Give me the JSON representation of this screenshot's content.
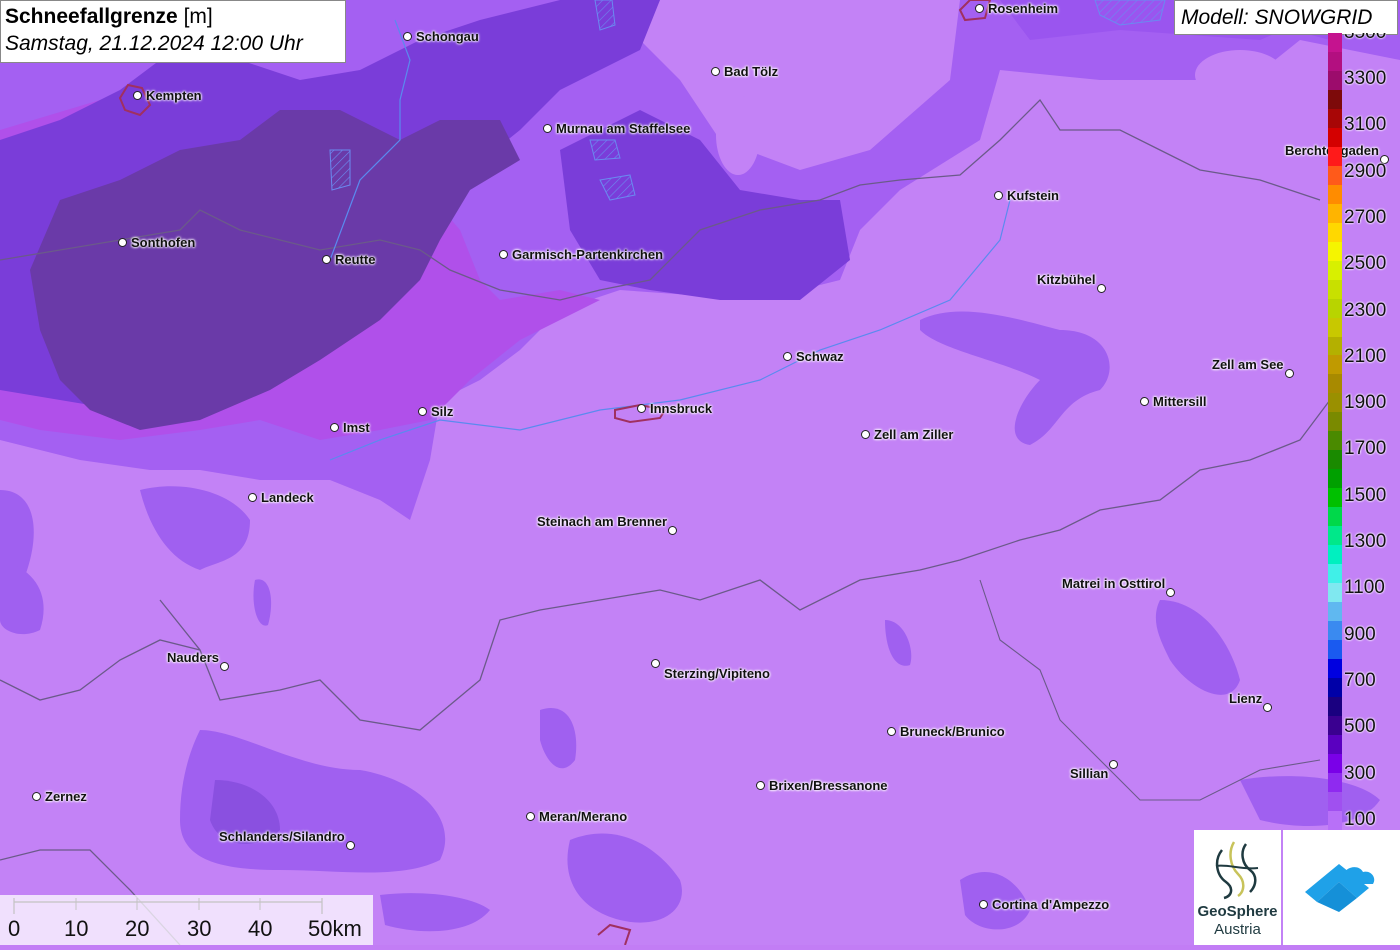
{
  "title": {
    "param": "Schneefallgrenze",
    "unit": "[m]",
    "datetime": "Samstag, 21.12.2024 12:00 Uhr"
  },
  "model": "Modell: SNOWGRID",
  "cities": [
    {
      "name": "Rosenheim"
    },
    {
      "name": "Schongau"
    },
    {
      "name": "Kempten"
    },
    {
      "name": "Bad Tölz"
    },
    {
      "name": "Murnau am Staffelsee"
    },
    {
      "name": "Berchtesgaden"
    },
    {
      "name": "Kufstein"
    },
    {
      "name": "Sonthofen"
    },
    {
      "name": "Reutte"
    },
    {
      "name": "Garmisch-Partenkirchen"
    },
    {
      "name": "Kitzbühel"
    },
    {
      "name": "Schwaz"
    },
    {
      "name": "Zell am See"
    },
    {
      "name": "Mittersill"
    },
    {
      "name": "Imst"
    },
    {
      "name": "Silz"
    },
    {
      "name": "Innsbruck"
    },
    {
      "name": "Zell am Ziller"
    },
    {
      "name": "Landeck"
    },
    {
      "name": "Steinach am Brenner"
    },
    {
      "name": "Matrei in Osttirol"
    },
    {
      "name": "Nauders"
    },
    {
      "name": "Sterzing/Vipiteno"
    },
    {
      "name": "Lienz"
    },
    {
      "name": "Bruneck/Brunico"
    },
    {
      "name": "Sillian"
    },
    {
      "name": "Brixen/Bressanone"
    },
    {
      "name": "Zernez"
    },
    {
      "name": "Meran/Merano"
    },
    {
      "name": "Schlanders/Silandro"
    },
    {
      "name": "Cortina d'Ampezzo"
    }
  ],
  "legend": {
    "labels": [
      "3300",
      "3100",
      "2900",
      "2700",
      "2500",
      "2300",
      "2100",
      "1900",
      "1700",
      "1500",
      "1300",
      "1100",
      "900",
      "700",
      "500",
      "300",
      "100"
    ],
    "colors": [
      "#c5138f",
      "#b30f80",
      "#9c0c6c",
      "#7d0a0a",
      "#a80606",
      "#d40000",
      "#ff1a1a",
      "#ff5a1a",
      "#ff8c00",
      "#ffb400",
      "#ffd800",
      "#f5f500",
      "#d8f000",
      "#c8e000",
      "#b8d400",
      "#c8c800",
      "#b4b000",
      "#c09a00",
      "#a88a00",
      "#9a9000",
      "#7a8a00",
      "#4a8a00",
      "#1a8a00",
      "#00a000",
      "#00c000",
      "#00d84a",
      "#00e88a",
      "#00f0c0",
      "#40f0e8",
      "#80e8f0",
      "#60b8f0",
      "#3a8af0",
      "#1a5af0",
      "#0000e0",
      "#0000a8",
      "#1a0080",
      "#3a0090",
      "#5a00c0",
      "#7a00e8",
      "#8f2af0",
      "#a050f0",
      "#b870f8"
    ],
    "top_cut": "3500"
  },
  "scale": {
    "labels": [
      "0",
      "10",
      "20",
      "30",
      "40",
      "50km"
    ]
  },
  "logos": {
    "geosphere_line1": "GeoSphere",
    "geosphere_line2": "Austria"
  }
}
